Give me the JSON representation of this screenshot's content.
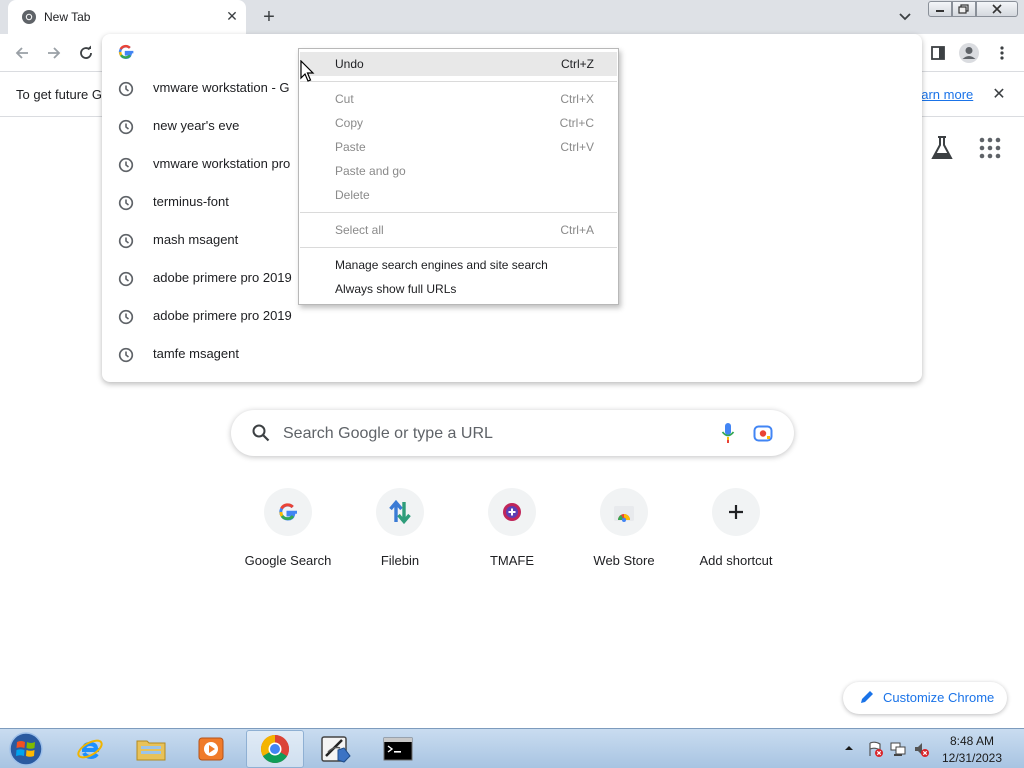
{
  "tab": {
    "title": "New Tab",
    "icon": "chrome-icon"
  },
  "infobar": {
    "text": "To get future G",
    "link": "earn more"
  },
  "omnibox": {
    "icon": "google-g-icon"
  },
  "suggestions": [
    {
      "text": "vmware workstation - G"
    },
    {
      "text": "new year's eve"
    },
    {
      "text": "vmware workstation pro"
    },
    {
      "text": "terminus-font"
    },
    {
      "text": "mash msagent"
    },
    {
      "text": "adobe primere pro 2019"
    },
    {
      "text": "adobe primere pro 2019"
    },
    {
      "text": "tamfe msagent"
    }
  ],
  "context_menu": {
    "undo": {
      "label": "Undo",
      "shortcut": "Ctrl+Z"
    },
    "cut": {
      "label": "Cut",
      "shortcut": "Ctrl+X"
    },
    "copy": {
      "label": "Copy",
      "shortcut": "Ctrl+C"
    },
    "paste": {
      "label": "Paste",
      "shortcut": "Ctrl+V"
    },
    "paste_go": {
      "label": "Paste and go"
    },
    "delete": {
      "label": "Delete"
    },
    "select_all": {
      "label": "Select all",
      "shortcut": "Ctrl+A"
    },
    "manage": {
      "label": "Manage search engines and site search"
    },
    "full_urls": {
      "label": "Always show full URLs"
    }
  },
  "ntp": {
    "search_placeholder": "Search Google or type a URL",
    "shortcuts": [
      {
        "label": "Google Search",
        "icon": "google-g-icon"
      },
      {
        "label": "Filebin",
        "icon": "filebin-arrows-icon"
      },
      {
        "label": "TMAFE",
        "icon": "tmafe-icon"
      },
      {
        "label": "Web Store",
        "icon": "web-store-icon"
      },
      {
        "label": "Add shortcut",
        "icon": "plus-icon"
      }
    ],
    "customize_label": "Customize Chrome"
  },
  "taskbar": {
    "apps": [
      "internet-explorer-icon",
      "file-explorer-icon",
      "media-player-icon",
      "chrome-icon",
      "control-panel-icon",
      "command-prompt-icon"
    ],
    "time": "8:48 AM",
    "date": "12/31/2023"
  },
  "colors": {
    "accent": "#1a73e8",
    "tabstrip": "#dee1e6",
    "menu_highlight": "#e8e8e8"
  }
}
